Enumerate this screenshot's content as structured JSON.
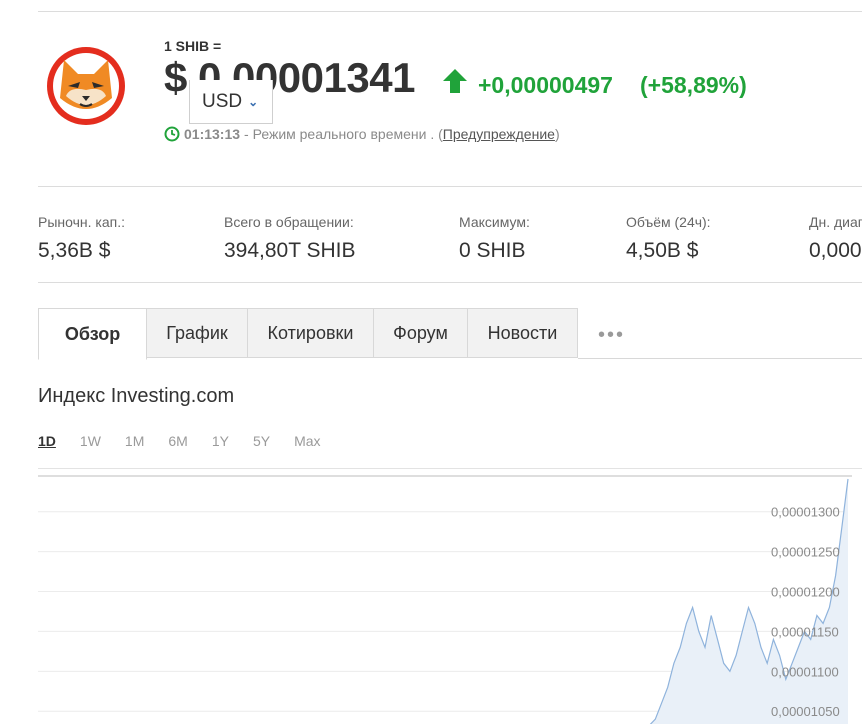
{
  "header": {
    "pair_label": "1 SHIB =",
    "price": "$ 0,00001341",
    "currency": "USD",
    "change": "+0,00000497",
    "change_pct": "(+58,89%)",
    "time": "01:13:13",
    "status_text": " - Режим реального времени . ( ",
    "warning_link": "Предупреждение",
    "status_close": " )",
    "accent_up": "#20a33a"
  },
  "stats": [
    {
      "label": "Рыночн. кап.:",
      "value": "5,36B $"
    },
    {
      "label": "Всего в обращении:",
      "value": "394,80T SHIB"
    },
    {
      "label": "Максимум:",
      "value": "0 SHIB"
    },
    {
      "label": "Объём (24ч):",
      "value": "4,50B $"
    },
    {
      "label": "Дн. диапазон:",
      "value": "0,000"
    }
  ],
  "tabs": [
    "Обзор",
    "График",
    "Котировки",
    "Форум",
    "Новости"
  ],
  "more_label": "•••",
  "index_title": "Индекс Investing.com",
  "ranges": [
    "1D",
    "1W",
    "1M",
    "6M",
    "1Y",
    "5Y",
    "Max"
  ],
  "chart_data": {
    "type": "area",
    "y_tick_labels": [
      "0,00001300",
      "0,00001250",
      "0,00001200",
      "0,00001150",
      "0,00001100",
      "0,00001050"
    ],
    "y_ticks": [
      1.3e-05,
      1.25e-05,
      1.2e-05,
      1.15e-05,
      1.1e-05,
      1.05e-05
    ],
    "ylim": [
      1.034e-05,
      1.341e-05
    ],
    "grid": true,
    "line_color": "#8fb3dc",
    "fill_color": "#e9f0f8",
    "values": [
      1.03e-05,
      1.03e-05,
      1.031e-05,
      1.03e-05,
      1.033e-05,
      1.032e-05,
      1.04e-05,
      1.06e-05,
      1.08e-05,
      1.11e-05,
      1.13e-05,
      1.16e-05,
      1.18e-05,
      1.15e-05,
      1.13e-05,
      1.17e-05,
      1.14e-05,
      1.11e-05,
      1.1e-05,
      1.12e-05,
      1.15e-05,
      1.18e-05,
      1.16e-05,
      1.13e-05,
      1.11e-05,
      1.14e-05,
      1.12e-05,
      1.09e-05,
      1.11e-05,
      1.13e-05,
      1.15e-05,
      1.14e-05,
      1.17e-05,
      1.16e-05,
      1.18e-05,
      1.22e-05,
      1.28e-05,
      1.341e-05
    ]
  }
}
